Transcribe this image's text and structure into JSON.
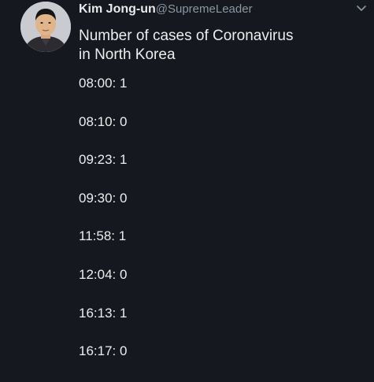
{
  "tweet": {
    "author": {
      "display_name": "Kim Jong-un",
      "handle": "@SupremeLeader",
      "avatar_icon": "profile-photo"
    },
    "menu_icon": "chevron-down-icon",
    "text_line1": "Number of cases of Coronavirus",
    "text_line2": "in North Korea",
    "entries": [
      "08:00: 1",
      "08:10: 0",
      "09:23: 1",
      "09:30: 0",
      "11:58: 1",
      "12:04: 0",
      "16:13: 1",
      "16:17: 0"
    ]
  },
  "colors": {
    "background": "#15181e",
    "text": "#eceded",
    "handle": "#8b97a1"
  }
}
